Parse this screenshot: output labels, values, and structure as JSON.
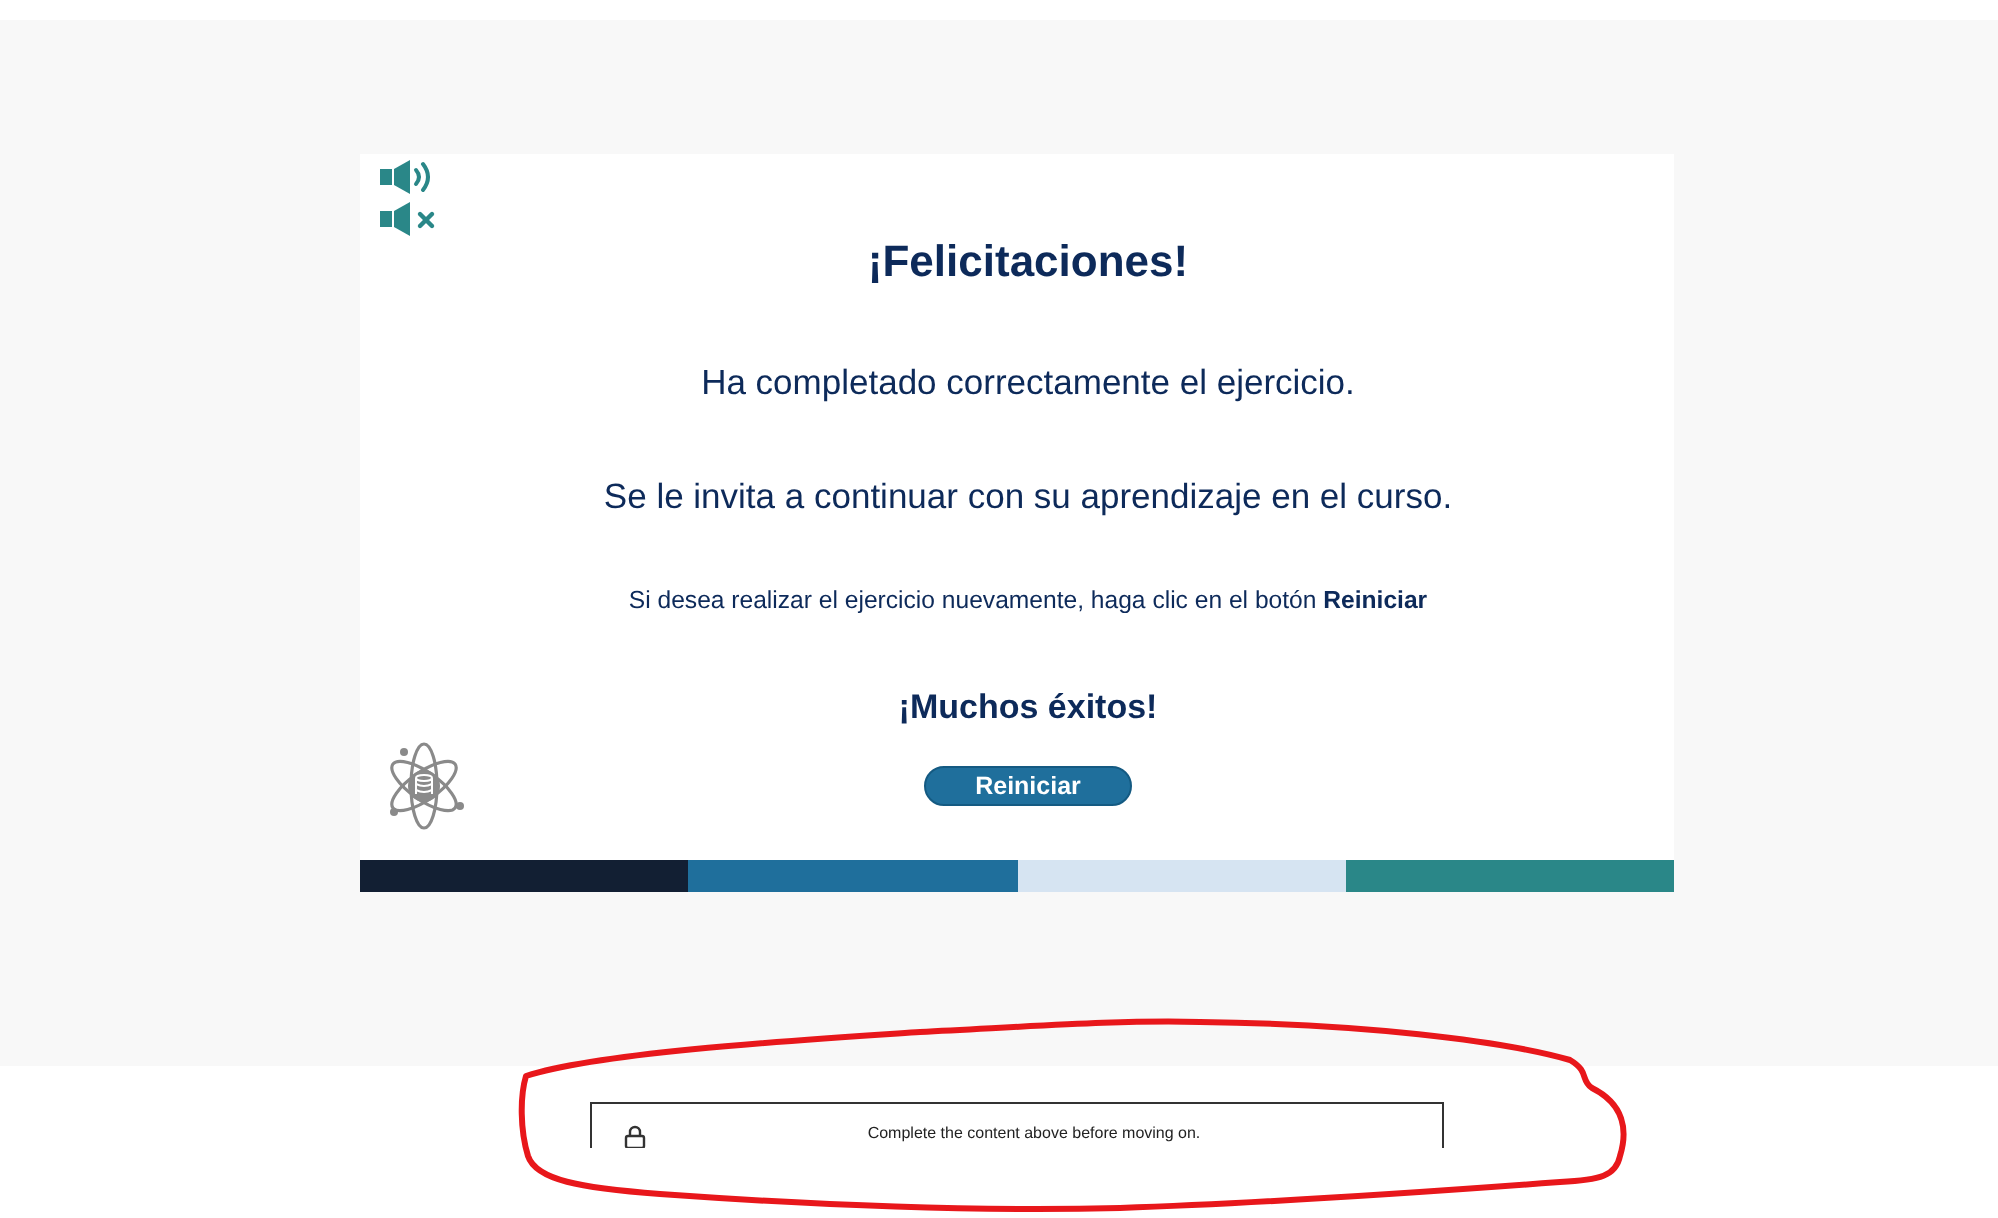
{
  "card": {
    "title": "¡Felicitaciones!",
    "messages": [
      "Ha completado correctamente el ejercicio.",
      "Se le invita a continuar con su aprendizaje en el curso."
    ],
    "hint": "Si desea realizar el ejercicio nuevamente, haga clic en el botón **Reiniciar**",
    "closing": "¡Muchos éxitos!",
    "button": "Reiniciar"
  },
  "color_stripes": [
    {
      "color": "#121f33"
    },
    {
      "color": "#1f6f9c"
    },
    {
      "color": "#d6e4f2"
    },
    {
      "color": "#2a8788"
    }
  ],
  "lock_notice": {
    "text": "Complete the content above before moving on."
  }
}
